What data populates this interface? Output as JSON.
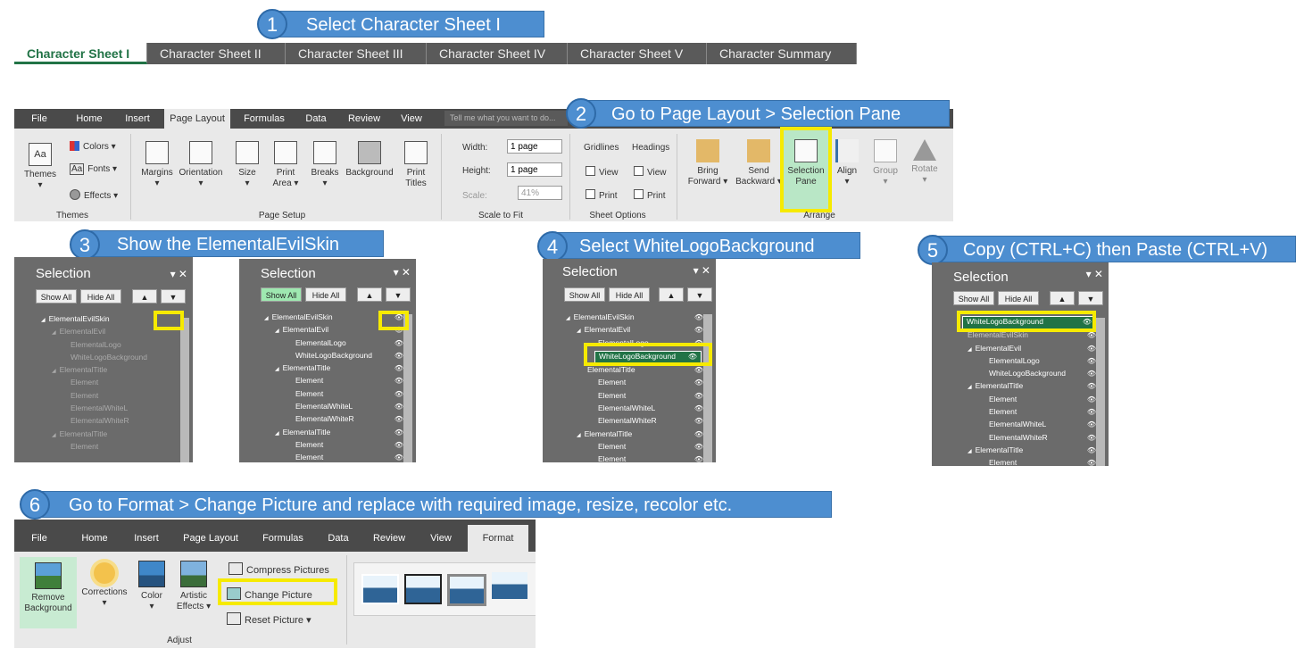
{
  "steps": [
    {
      "num": "1",
      "text": "Select Character Sheet I"
    },
    {
      "num": "2",
      "text": "Go to Page Layout > Selection Pane"
    },
    {
      "num": "3",
      "text": "Show the ElementalEvilSkin"
    },
    {
      "num": "4",
      "text": "Select WhiteLogoBackground"
    },
    {
      "num": "5",
      "text": "Copy (CTRL+C) then Paste (CTRL+V)"
    },
    {
      "num": "6",
      "text": "Go to Format > Change Picture and replace with required image, resize, recolor etc."
    }
  ],
  "sheet_tabs": [
    "Character Sheet I",
    "Character Sheet II",
    "Character Sheet III",
    "Character Sheet IV",
    "Character Sheet V",
    "Character Summary"
  ],
  "ribbon1": {
    "tabs": [
      "File",
      "Home",
      "Insert",
      "Page Layout",
      "Formulas",
      "Data",
      "Review",
      "View"
    ],
    "tell_me": "Tell me what you want to do...",
    "themes": "Themes",
    "colors": "Colors ▾",
    "fonts": "Fonts ▾",
    "effects": "Effects ▾",
    "margins": "Margins",
    "orientation": "Orientation",
    "size": "Size",
    "print_area_1": "Print",
    "print_area_2": "Area ▾",
    "breaks": "Breaks",
    "background": "Background",
    "print_titles_1": "Print",
    "print_titles_2": "Titles",
    "width": "Width:",
    "height": "Height:",
    "scale": "Scale:",
    "width_val": "1 page",
    "height_val": "1 page",
    "scale_val": "41%",
    "gridlines": "Gridlines",
    "headings": "Headings",
    "view": "View",
    "print": "Print",
    "bring_forward_1": "Bring",
    "bring_forward_2": "Forward ▾",
    "send_backward_1": "Send",
    "send_backward_2": "Backward ▾",
    "selection_pane_1": "Selection",
    "selection_pane_2": "Pane",
    "align": "Align",
    "group": "Group",
    "rotate": "Rotate",
    "grp_themes": "Themes",
    "grp_page_setup": "Page Setup",
    "grp_scale": "Scale to Fit",
    "grp_sheet": "Sheet Options",
    "grp_arrange": "Arrange"
  },
  "pane": {
    "title": "Selection",
    "show_all": "Show All",
    "hide_all": "Hide All",
    "items": [
      "ElementalEvilSkin",
      "ElementalEvil",
      "ElementalLogo",
      "WhiteLogoBackground",
      "ElementalTitle",
      "Element",
      "Element",
      "ElementalWhiteL",
      "ElementalWhiteR",
      "ElementalTitle",
      "Element",
      "Element"
    ],
    "pane4_items": [
      "ElementalEvilSkin",
      "ElementalEvil",
      "ElementalLogo",
      "WhiteLogoBackground",
      "ElementalTitle",
      "Element",
      "Element",
      "ElementalWhiteL",
      "ElementalWhiteR",
      "ElementalTitle",
      "Element",
      "Element"
    ],
    "pane5_items": [
      "WhiteLogoBackground",
      "ElementalEvilSkin",
      "ElementalEvil",
      "ElementalLogo",
      "WhiteLogoBackground",
      "ElementalTitle",
      "Element",
      "Element",
      "ElementalWhiteL",
      "ElementalWhiteR",
      "ElementalTitle",
      "Element"
    ]
  },
  "ribbon2": {
    "tabs": [
      "File",
      "Home",
      "Insert",
      "Page Layout",
      "Formulas",
      "Data",
      "Review",
      "View",
      "Format"
    ],
    "remove_bg_1": "Remove",
    "remove_bg_2": "Background",
    "corrections": "Corrections",
    "color": "Color",
    "artistic_1": "Artistic",
    "artistic_2": "Effects ▾",
    "compress": "Compress Pictures",
    "change": "Change Picture",
    "reset": "Reset Picture",
    "grp_adjust": "Adjust"
  },
  "colors": {
    "accent": "#4d8ed0",
    "excel_green": "#217346",
    "highlight": "#f6ea00"
  }
}
